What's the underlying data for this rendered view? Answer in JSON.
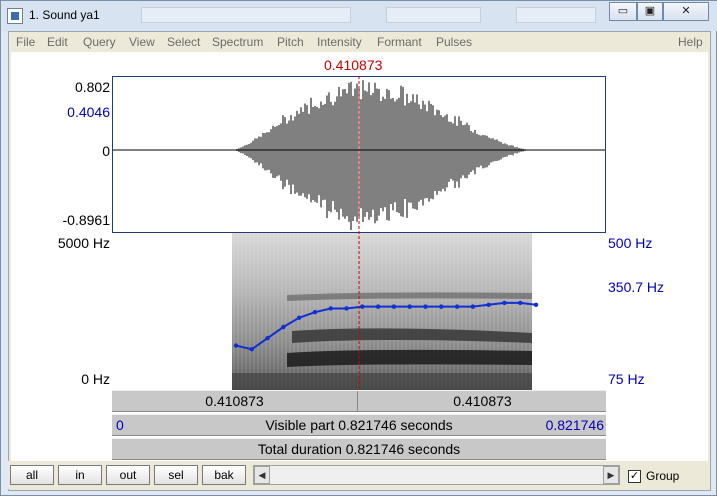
{
  "window": {
    "title": "1. Sound ya1",
    "controls": {
      "minimize": "▭",
      "maximize": "▣",
      "close": "✕"
    }
  },
  "menu": {
    "items": [
      "File",
      "Edit",
      "Query",
      "View",
      "Select",
      "Spectrum",
      "Pitch",
      "Intensity",
      "Formant",
      "Pulses",
      "Help"
    ]
  },
  "cursor": {
    "time": "0.410873"
  },
  "waveform": {
    "ymax": "0.802",
    "ymark": "0.4046",
    "zero": "0",
    "ymin": "-0.8961"
  },
  "spectrogram": {
    "freq_top": "5000 Hz",
    "freq_bottom": "0 Hz",
    "pitch_top": "500 Hz",
    "pitch_value": "350.7 Hz",
    "pitch_bottom": "75 Hz",
    "pitch_track": [
      0.24,
      0.22,
      0.28,
      0.34,
      0.39,
      0.42,
      0.44,
      0.44,
      0.45,
      0.45,
      0.45,
      0.45,
      0.45,
      0.45,
      0.45,
      0.45,
      0.46,
      0.47,
      0.47,
      0.46
    ]
  },
  "selection_bar": {
    "left": "0.410873",
    "right": "0.410873"
  },
  "visible_bar": {
    "start": "0",
    "text": "Visible part 0.821746 seconds",
    "end": "0.821746"
  },
  "total_bar": {
    "text": "Total duration 0.821746 seconds"
  },
  "toolbar": {
    "buttons": [
      "all",
      "in",
      "out",
      "sel",
      "bak"
    ],
    "group_label": "Group",
    "group_checked": "✓"
  },
  "colors": {
    "pitch": "#1030d0",
    "cursor": "#c80000",
    "axis_blue": "#0000b4"
  }
}
